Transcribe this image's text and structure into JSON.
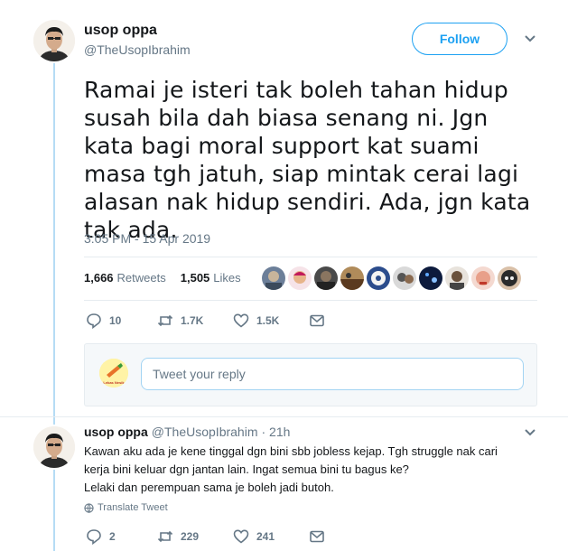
{
  "tweet": {
    "name": "usop oppa",
    "handle": "@TheUsopIbrahim",
    "follow_label": "Follow",
    "text": "Ramai je isteri tak boleh tahan hidup susah bila dah biasa senang ni. Jgn kata bagi moral support kat suami masa tgh jatuh, siap mintak cerai lagi alasan nak hidup sendiri. Ada, jgn kata tak ada.",
    "timestamp": "3:05 PM - 15 Apr 2019",
    "retweets_count": "1,666",
    "retweets_label": "Retweets",
    "likes_count": "1,505",
    "likes_label": "Likes",
    "actions": {
      "replies": "10",
      "retweets": "1.7K",
      "likes": "1.5K"
    }
  },
  "reply_box": {
    "placeholder": "Tweet your reply",
    "avatar_text": "Lekas Nesik"
  },
  "reply": {
    "name": "usop oppa",
    "handle": "@TheUsopIbrahim",
    "time": "· 21h",
    "lines": [
      "Kawan aku ada je kene tinggal dgn bini sbb jobless kejap. Tgh struggle nak cari",
      "kerja bini keluar dgn jantan lain. Ingat semua bini tu bagus ke?",
      "Lelaki dan perempuan sama je boleh jadi butoh."
    ],
    "translate_label": "Translate Tweet",
    "actions": {
      "replies": "2",
      "retweets": "229",
      "likes": "241"
    }
  },
  "colors": {
    "accent": "#1da1f2",
    "muted": "#657786",
    "text": "#14171a",
    "thread": "#b6dcf5"
  }
}
